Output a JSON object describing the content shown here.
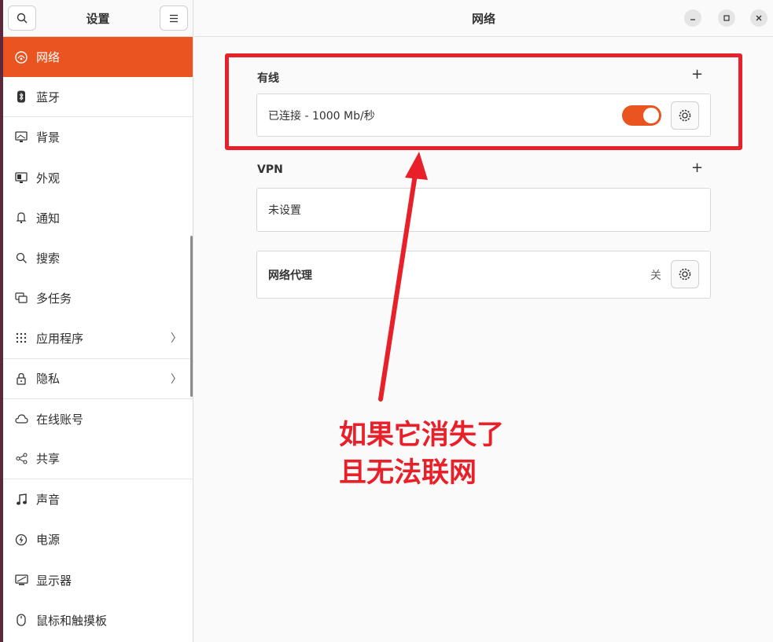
{
  "sidebar": {
    "title": "设置",
    "search_icon": "search-icon",
    "menu_icon": "hamburger-menu-icon",
    "items": [
      {
        "label": "网络",
        "icon": "network-icon"
      },
      {
        "label": "蓝牙",
        "icon": "bluetooth-icon"
      },
      {
        "label": "背景",
        "icon": "background-icon"
      },
      {
        "label": "外观",
        "icon": "appearance-icon"
      },
      {
        "label": "通知",
        "icon": "bell-icon"
      },
      {
        "label": "搜索",
        "icon": "search-icon"
      },
      {
        "label": "多任务",
        "icon": "multitasking-icon"
      },
      {
        "label": "应用程序",
        "icon": "apps-grid-icon"
      },
      {
        "label": "隐私",
        "icon": "lock-icon"
      },
      {
        "label": "在线账号",
        "icon": "cloud-icon"
      },
      {
        "label": "共享",
        "icon": "share-icon"
      },
      {
        "label": "声音",
        "icon": "music-note-icon"
      },
      {
        "label": "电源",
        "icon": "power-icon"
      },
      {
        "label": "显示器",
        "icon": "display-icon"
      },
      {
        "label": "鼠标和触摸板",
        "icon": "mouse-icon"
      }
    ]
  },
  "main": {
    "title": "网络",
    "wired": {
      "label": "有线",
      "add": "+",
      "status": "已连接 - 1000 Mb/秒",
      "toggle_on": true
    },
    "vpn": {
      "label": "VPN",
      "add": "+",
      "status": "未设置"
    },
    "proxy": {
      "label": "网络代理",
      "state": "关"
    }
  },
  "annotation": {
    "line1": "如果它消失了",
    "line2": "且无法联网"
  },
  "colors": {
    "accent": "#e95420",
    "annotation": "#e8202a"
  }
}
